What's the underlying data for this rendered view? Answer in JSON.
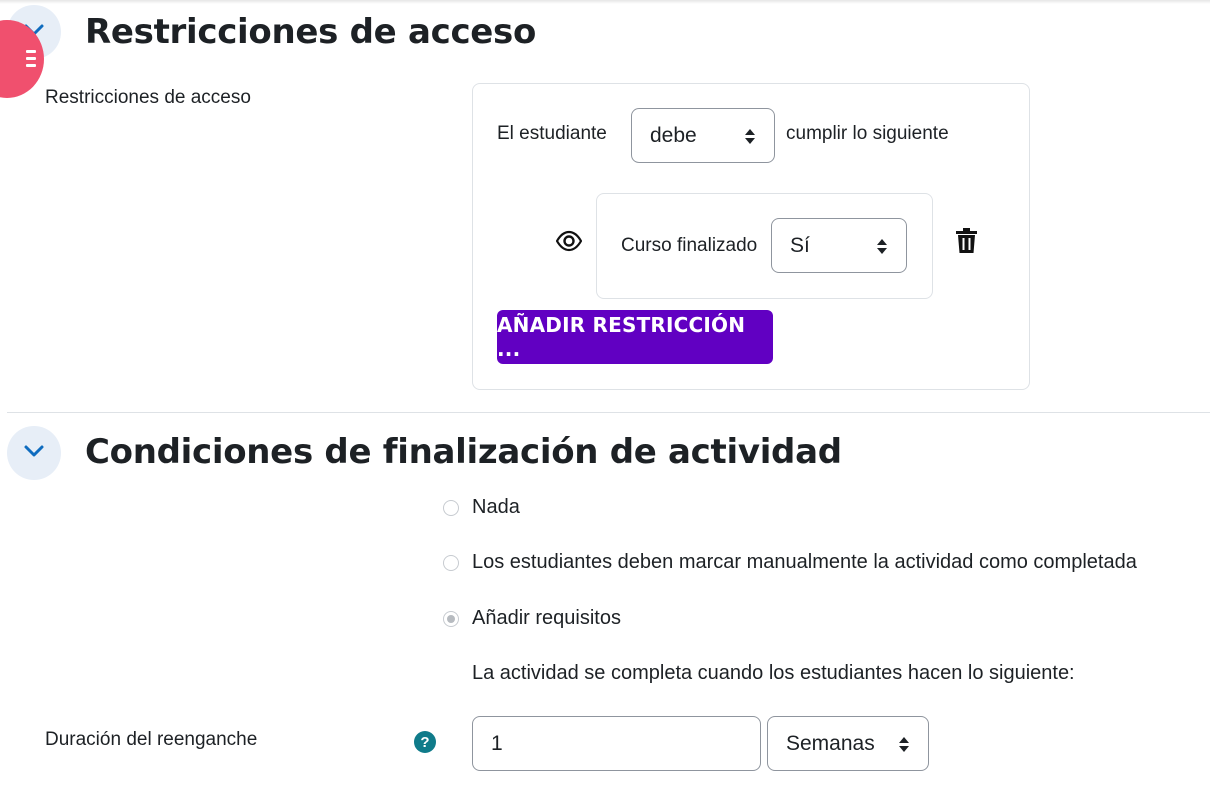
{
  "access_section": {
    "title": "Restricciones de acceso",
    "field_label": "Restricciones de acceso",
    "student_prefix": "El estudiante",
    "must_select": "debe",
    "student_suffix": "cumplir lo siguiente",
    "condition_label": "Curso finalizado",
    "condition_value": "Sí",
    "add_button": "AÑADIR RESTRICCIÓN ..."
  },
  "completion_section": {
    "title": "Condiciones de finalización de actividad",
    "options": [
      {
        "label": "Nada",
        "checked": false
      },
      {
        "label": "Los estudiantes deben marcar manualmente la actividad como completada",
        "checked": false
      },
      {
        "label": "Añadir requisitos",
        "checked": true
      }
    ],
    "requirements_text": "La actividad se completa cuando los estudiantes hacen lo siguiente:"
  },
  "reengagement": {
    "label": "Duración del reenganche",
    "help_glyph": "?",
    "value": "1",
    "unit": "Semanas"
  },
  "icons": {
    "collapse": "chevron-down-icon",
    "visibility": "eye-icon",
    "delete": "trash-icon",
    "help": "question-circle-icon",
    "menu": "menu-icon"
  },
  "colors": {
    "primary_button": "#6100c2",
    "collapse_bg": "#e7eef7",
    "chevron": "#0f6cbf",
    "help": "#0f7b8a",
    "fab": "#f0506e"
  }
}
